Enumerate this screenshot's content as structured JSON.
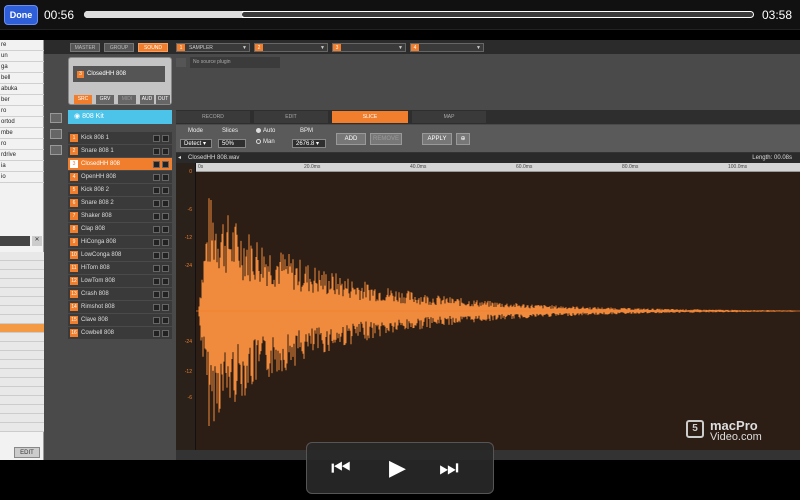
{
  "video": {
    "done_label": "Done",
    "time_current": "00:56",
    "time_end": "03:58",
    "progress": 0.2
  },
  "left_panel": {
    "items": [
      "re",
      "un",
      "ga",
      "bell",
      "abuka",
      "ber",
      "ro",
      "ortod",
      "mbe",
      "ro",
      "rdrive",
      "ia",
      "io"
    ],
    "edit_label": "EDIT"
  },
  "strip": {
    "master": "MASTER",
    "group": "GROUP",
    "sound": "SOUND",
    "slots": [
      {
        "num": "1",
        "label": "SAMPLER"
      },
      {
        "num": "2",
        "label": ""
      },
      {
        "num": "3",
        "label": ""
      },
      {
        "num": "4",
        "label": ""
      }
    ]
  },
  "sound_card": {
    "num": "3",
    "name": "ClosedHH 808",
    "tabs": [
      "SRC",
      "GRV",
      "MIDI",
      "AUD",
      "OUT"
    ],
    "source_plugin": "No source plugin"
  },
  "kit": {
    "name": "808 Kit",
    "sounds": [
      {
        "num": "1",
        "name": "Kick 808 1"
      },
      {
        "num": "2",
        "name": "Snare 808 1"
      },
      {
        "num": "3",
        "name": "ClosedHH 808"
      },
      {
        "num": "4",
        "name": "OpenHH 808"
      },
      {
        "num": "5",
        "name": "Kick 808 2"
      },
      {
        "num": "6",
        "name": "Snare 808 2"
      },
      {
        "num": "7",
        "name": "Shaker 808"
      },
      {
        "num": "8",
        "name": "Clap 808"
      },
      {
        "num": "9",
        "name": "HiConga 808"
      },
      {
        "num": "10",
        "name": "LowConga 808"
      },
      {
        "num": "11",
        "name": "HiTom 808"
      },
      {
        "num": "12",
        "name": "LowTom 808"
      },
      {
        "num": "13",
        "name": "Crash 808"
      },
      {
        "num": "14",
        "name": "Rimshot 808"
      },
      {
        "num": "15",
        "name": "Clave 808"
      },
      {
        "num": "16",
        "name": "Cowbell 808"
      }
    ],
    "selected_index": 2
  },
  "editor": {
    "tabs": [
      "RECORD",
      "EDIT",
      "SLICE",
      "MAP"
    ],
    "active_tab": "SLICE",
    "mode_label": "Mode",
    "mode_value": "Detect",
    "slices_label": "Slices",
    "slices_value": "50%",
    "auto_label": "Auto",
    "man_label": "Man",
    "bpm_label": "BPM",
    "bpm_value": "2676.8",
    "add_label": "ADD",
    "remove_label": "REMOVE",
    "apply_label": "APPLY",
    "file_name": "ClosedHH 808.wav",
    "length_label": "Length: 00.08s",
    "ruler_ticks": [
      "0s",
      "20.0ms",
      "40.0ms",
      "60.0ms",
      "80.0ms",
      "100.0ms"
    ],
    "y_labels": [
      "0",
      "-6",
      "-12",
      "-24",
      "-24",
      "-12",
      "-6"
    ]
  },
  "branding": {
    "logo_line1": "macPro",
    "logo_line2": "Video.com"
  },
  "player": {
    "rewind": "⏮",
    "play": "▶",
    "forward": "⏭"
  },
  "colors": {
    "accent": "#f07e2c",
    "kit_header": "#4cc3e8",
    "waveform_bg": "#2d1e15"
  }
}
